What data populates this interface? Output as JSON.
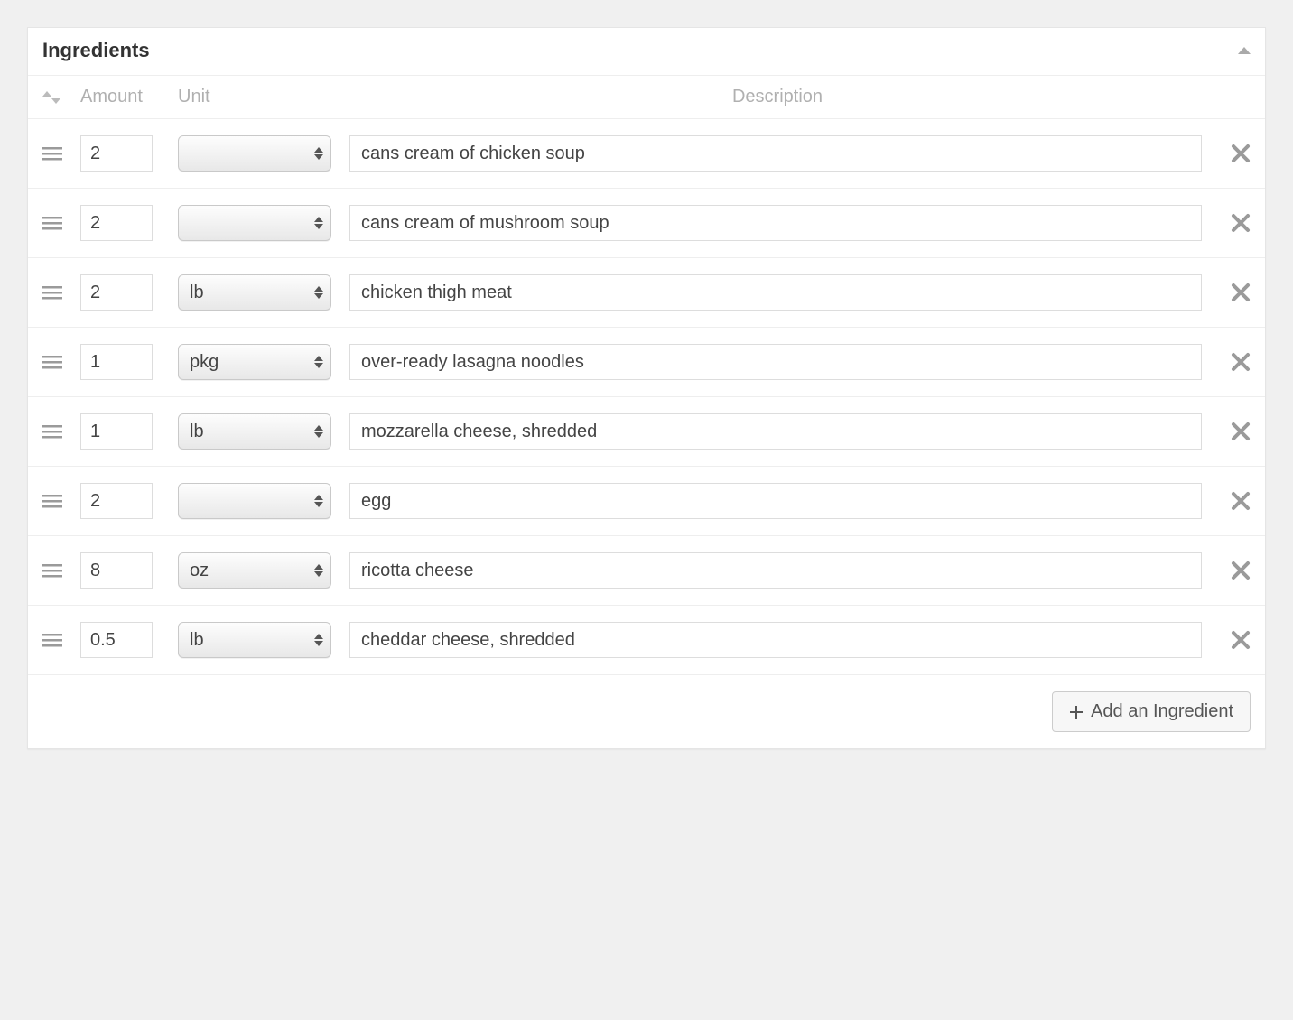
{
  "panel": {
    "title": "Ingredients",
    "add_label": "Add an Ingredient"
  },
  "headers": {
    "amount": "Amount",
    "unit": "Unit",
    "description": "Description"
  },
  "unit_options": [
    "",
    "lb",
    "pkg",
    "oz"
  ],
  "rows": [
    {
      "amount": "2",
      "unit": "",
      "description": "cans cream of chicken soup"
    },
    {
      "amount": "2",
      "unit": "",
      "description": "cans cream of mushroom soup"
    },
    {
      "amount": "2",
      "unit": "lb",
      "description": "chicken thigh meat"
    },
    {
      "amount": "1",
      "unit": "pkg",
      "description": "over-ready lasagna noodles"
    },
    {
      "amount": "1",
      "unit": "lb",
      "description": "mozzarella cheese, shredded"
    },
    {
      "amount": "2",
      "unit": "",
      "description": "egg"
    },
    {
      "amount": "8",
      "unit": "oz",
      "description": "ricotta cheese"
    },
    {
      "amount": "0.5",
      "unit": "lb",
      "description": "cheddar cheese, shredded"
    }
  ]
}
